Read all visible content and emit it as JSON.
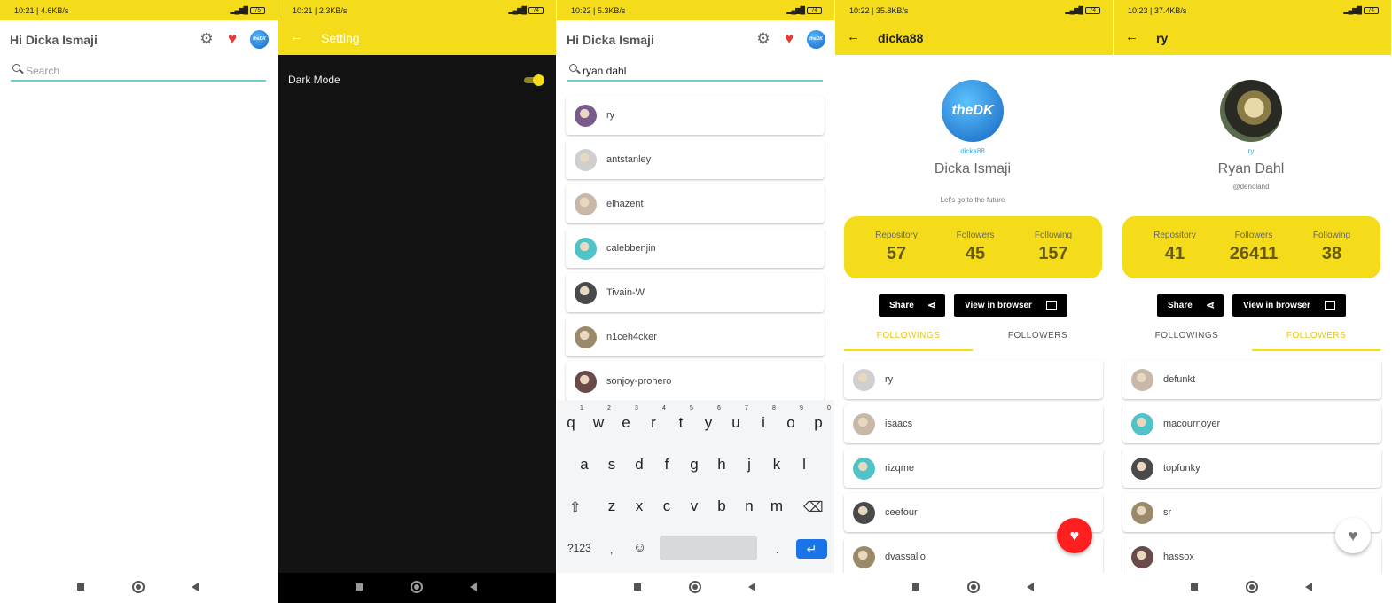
{
  "colors": {
    "accent": "#f4dc1b",
    "heart": "#e53935",
    "fab_red": "#ff1f1f",
    "link": "#34a6e8",
    "search_line": "#6fd0c8",
    "dark_bg": "#131313"
  },
  "screens": [
    {
      "status": {
        "time": "10:21 | 4.6KB/s",
        "battery": "75"
      },
      "header": {
        "title": "Hi Dicka Ismaji",
        "avatar_text": "theDK"
      },
      "search": {
        "placeholder": "Search",
        "value": ""
      }
    },
    {
      "status": {
        "time": "10:21 | 2.3KB/s",
        "battery": "74"
      },
      "toolbar": {
        "title": "Setting"
      },
      "settings": {
        "dark_mode_label": "Dark Mode",
        "dark_mode_on": true
      }
    },
    {
      "status": {
        "time": "10:22 | 5.3KB/s",
        "battery": "74"
      },
      "header": {
        "title": "Hi Dicka Ismaji",
        "avatar_text": "theDK"
      },
      "search": {
        "placeholder": "Search",
        "value": "ryan dahl"
      },
      "results": [
        "ry",
        "antstanley",
        "elhazent",
        "calebbenjin",
        "Tivain-W",
        "n1ceh4cker",
        "sonjoy-prohero"
      ],
      "keyboard": {
        "row1": [
          "q",
          "w",
          "e",
          "r",
          "t",
          "y",
          "u",
          "i",
          "o",
          "p"
        ],
        "row1_nums": [
          "1",
          "2",
          "3",
          "4",
          "5",
          "6",
          "7",
          "8",
          "9",
          "0"
        ],
        "row2": [
          "a",
          "s",
          "d",
          "f",
          "g",
          "h",
          "j",
          "k",
          "l"
        ],
        "row3": [
          "z",
          "x",
          "c",
          "v",
          "b",
          "n",
          "m"
        ],
        "sym_key": "?123",
        "comma": ",",
        "period": "."
      }
    },
    {
      "status": {
        "time": "10:22 | 35.8KB/s",
        "battery": "74"
      },
      "toolbar": {
        "title": "dicka88"
      },
      "profile": {
        "login": "dicka88",
        "name": "Dicka Ismaji",
        "company": "",
        "bio": "Let's go to the future",
        "avatar_text": "theDK",
        "repository_label": "Repository",
        "repository": "57",
        "followers_label": "Followers",
        "followers": "45",
        "following_label": "Following",
        "following": "157"
      },
      "buttons": {
        "share": "Share",
        "browser": "View in browser"
      },
      "tabs": {
        "followings": "FOLLOWINGS",
        "followers": "FOLLOWERS",
        "active": "followings"
      },
      "list": [
        "ry",
        "isaacs",
        "rizqme",
        "ceefour",
        "dvassallo"
      ],
      "favorite": true
    },
    {
      "status": {
        "time": "10:23 | 37.4KB/s",
        "battery": "74"
      },
      "toolbar": {
        "title": "ry"
      },
      "profile": {
        "login": "ry",
        "name": "Ryan Dahl",
        "company": "@denoland",
        "bio": "",
        "repository_label": "Repository",
        "repository": "41",
        "followers_label": "Followers",
        "followers": "26411",
        "following_label": "Following",
        "following": "38"
      },
      "buttons": {
        "share": "Share",
        "browser": "View in browser"
      },
      "tabs": {
        "followings": "FOLLOWINGS",
        "followers": "FOLLOWERS",
        "active": "followers"
      },
      "list": [
        "defunkt",
        "macournoyer",
        "topfunky",
        "sr",
        "hassox"
      ],
      "favorite": false
    }
  ]
}
